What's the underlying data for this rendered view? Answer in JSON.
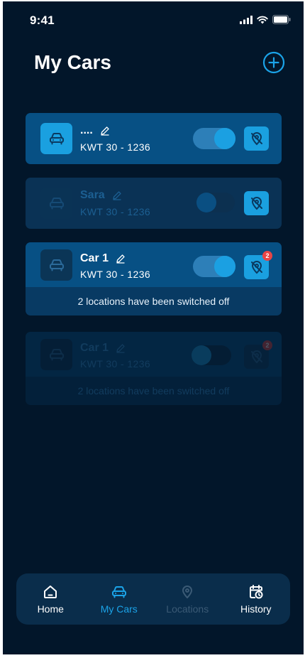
{
  "status_bar": {
    "time": "9:41"
  },
  "header": {
    "title": "My Cars"
  },
  "cars": [
    {
      "name": "....",
      "plate": "KWT  30 - 1236",
      "toggle": "on",
      "active": true,
      "notice": null
    },
    {
      "name": "Sara",
      "plate": "KWT  30 - 1236",
      "toggle": "off",
      "active": false,
      "notice": null
    },
    {
      "name": "Car 1",
      "plate": "KWT  30 - 1236",
      "toggle": "on",
      "active": true,
      "badge": "2",
      "notice": "2  locations have been switched off"
    },
    {
      "name": "Car 1",
      "plate": "KWT  30 - 1236",
      "toggle": "off",
      "active": false,
      "badge": "2",
      "notice": "2  locations have been switched off"
    }
  ],
  "tabs": [
    {
      "label": "Home",
      "icon": "home-icon",
      "state": "default"
    },
    {
      "label": "My Cars",
      "icon": "car-icon",
      "state": "selected"
    },
    {
      "label": "Locations",
      "icon": "location-pin-icon",
      "state": "disabled"
    },
    {
      "label": "History",
      "icon": "calendar-clock-icon",
      "state": "default"
    }
  ],
  "colors": {
    "background": "#02162a",
    "accent": "#1aa0e0",
    "card": "#075084",
    "badge": "#e84545",
    "tab_disabled": "#3b5a75"
  }
}
